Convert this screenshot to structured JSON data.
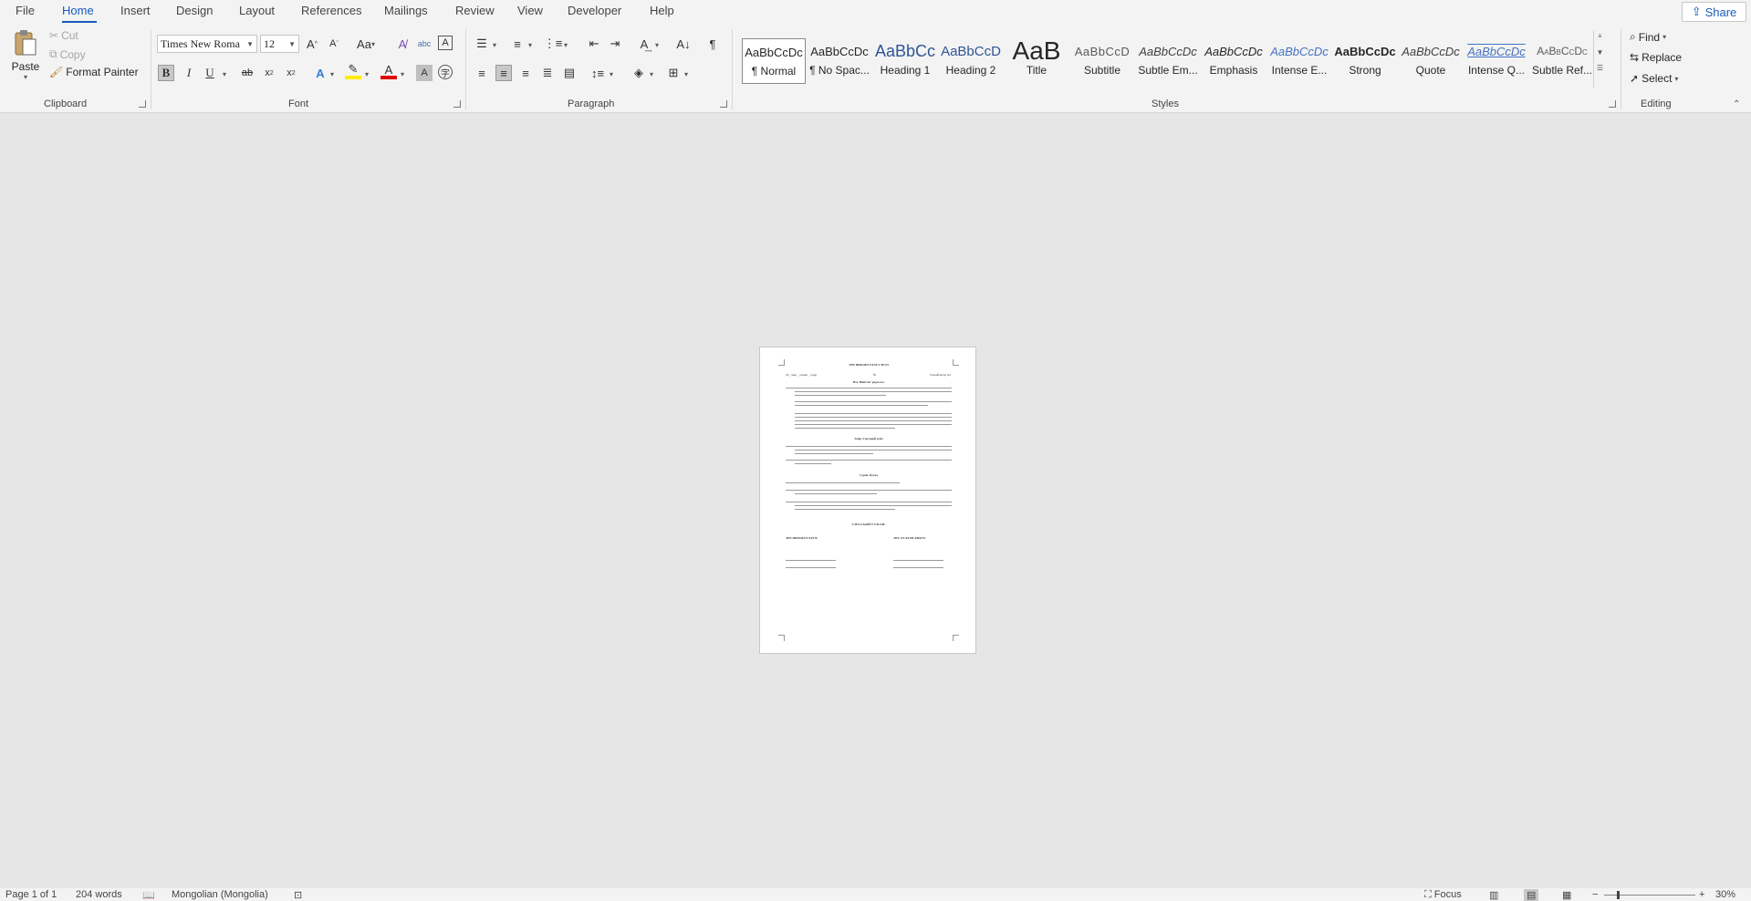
{
  "tabs": [
    "File",
    "Home",
    "Insert",
    "Design",
    "Layout",
    "References",
    "Mailings",
    "Review",
    "View",
    "Developer",
    "Help"
  ],
  "share_label": "Share",
  "clipboard": {
    "paste": "Paste",
    "cut": "Cut",
    "copy": "Copy",
    "format_painter": "Format Painter",
    "group": "Clipboard"
  },
  "font": {
    "name": "Times New Roma",
    "size": "12",
    "group": "Font"
  },
  "paragraph": {
    "group": "Paragraph"
  },
  "styles": {
    "group": "Styles",
    "items": [
      {
        "preview": "AaBbCcDc",
        "label": "¶ Normal"
      },
      {
        "preview": "AaBbCcDc",
        "label": "¶ No Spac..."
      },
      {
        "preview": "AaBbCc",
        "label": "Heading 1"
      },
      {
        "preview": "AaBbCcD",
        "label": "Heading 2"
      },
      {
        "preview": "AaB",
        "label": "Title"
      },
      {
        "preview": "AaBbCcD",
        "label": "Subtitle"
      },
      {
        "preview": "AaBbCcDc",
        "label": "Subtle Em..."
      },
      {
        "preview": "AaBbCcDc",
        "label": "Emphasis"
      },
      {
        "preview": "AaBbCcDc",
        "label": "Intense E..."
      },
      {
        "preview": "AaBbCcDc",
        "label": "Strong"
      },
      {
        "preview": "AaBbCcDc",
        "label": "Quote"
      },
      {
        "preview": "AaBbCcDc",
        "label": "Intense Q..."
      },
      {
        "preview": "AaBbCcDc",
        "label": "Subtle Ref..."
      }
    ]
  },
  "editing": {
    "find": "Find",
    "replace": "Replace",
    "select": "Select",
    "group": "Editing"
  },
  "document": {
    "title": "ЭРХ ШИЛЖҮҮЛЭХ ГЭРЭЭ",
    "place_date": "20_ оны _ сарын _ өдөр",
    "number": "№",
    "city": "Улаанбаатар хот",
    "sec1": "Нэг. Нийтлэг үндэслэл",
    "sec2": "Хоёр. Гэрээний зүйл",
    "sec3": "Гурав. Бусад",
    "signatures": "ГЭРЭЭ БАЙГУУЛСАН:",
    "sig_left": "ЭРХ ШИЛЖҮҮЛЭГЧ:",
    "sig_right": "ЭРХ ХҮЛЭЭН АВАГЧ:"
  },
  "status": {
    "page": "Page 1 of 1",
    "words": "204 words",
    "language": "Mongolian (Mongolia)",
    "focus": "Focus",
    "zoom": "30%"
  }
}
